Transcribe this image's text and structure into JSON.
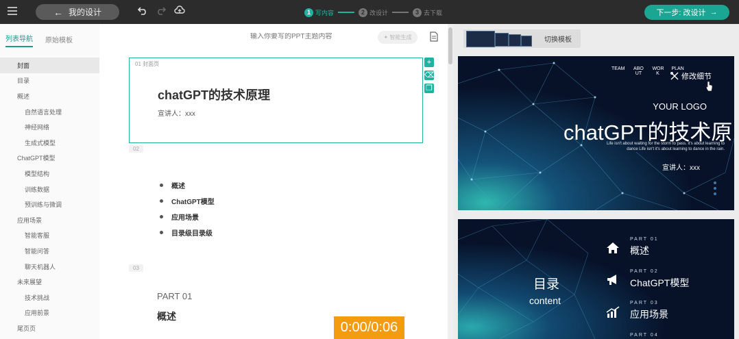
{
  "topbar": {
    "back_label": "我的设计",
    "steps": [
      {
        "num": "1",
        "label": "写内容",
        "active": true
      },
      {
        "num": "2",
        "label": "改设计",
        "active": false
      },
      {
        "num": "3",
        "label": "去下载",
        "active": false
      }
    ],
    "next_label": "下一步: 改设计"
  },
  "sidebar": {
    "tabs": [
      "列表导航",
      "原始模板"
    ],
    "outline": [
      {
        "label": "封面",
        "level": 1,
        "selected": true
      },
      {
        "label": "目录",
        "level": 1
      },
      {
        "label": "概述",
        "level": 1
      },
      {
        "label": "自然语言处理",
        "level": 2
      },
      {
        "label": "神经网络",
        "level": 2
      },
      {
        "label": "生成式模型",
        "level": 2
      },
      {
        "label": "ChatGPT模型",
        "level": 1
      },
      {
        "label": "模型结构",
        "level": 2
      },
      {
        "label": "训练数据",
        "level": 2
      },
      {
        "label": "预训练与微调",
        "level": 2
      },
      {
        "label": "应用场景",
        "level": 1
      },
      {
        "label": "智能客服",
        "level": 2
      },
      {
        "label": "智能问答",
        "level": 2
      },
      {
        "label": "聊天机器人",
        "level": 2
      },
      {
        "label": "未来展望",
        "level": 1
      },
      {
        "label": "技术挑战",
        "level": 2
      },
      {
        "label": "应用前景",
        "level": 2
      },
      {
        "label": "尾页页",
        "level": 1
      }
    ]
  },
  "editor": {
    "prompt_placeholder": "输入你要写的PPT主题内容",
    "generate_label": "✦ 智能生成",
    "cover": {
      "tag": "01 封面页",
      "title": "chatGPT的技术原理",
      "presenter": "宣讲人：xxx"
    },
    "toc_num": "02",
    "toc_items": [
      "概述",
      "ChatGPT模型",
      "应用场景",
      "目录级目录级"
    ],
    "part_num": "03",
    "part_label": "PART 01",
    "part_title": "概述",
    "timer": "0:00/0:06"
  },
  "preview": {
    "switch_label": "切换模板",
    "slide1": {
      "nav": [
        "TEAM",
        "ABO UT",
        "WOR K",
        "PLAN"
      ],
      "edit_detail": "修改细节",
      "logo": "YOUR LOGO",
      "title": "chatGPT的技术原",
      "small_text": "Life isn't about waiting for the storm to pass. it's about learning to dance Life isn't it's about learning to dance in the rain.",
      "presenter": "宣讲人：xxx"
    },
    "slide2": {
      "toc_title": "目录",
      "toc_sub": "content",
      "items": [
        {
          "part": "PART 01",
          "name": "概述",
          "icon": "home-icon"
        },
        {
          "part": "PART 02",
          "name": "ChatGPT模型",
          "icon": "megaphone-icon"
        },
        {
          "part": "PART 03",
          "name": "应用场景",
          "icon": "chart-icon"
        },
        {
          "part": "PART 04",
          "name": "",
          "icon": "generic-icon"
        }
      ]
    }
  },
  "colors": {
    "accent": "#21b3a1",
    "topbar_bg": "#2c2c2c",
    "timer": "#f39c12",
    "slide_bg": "#081530"
  }
}
